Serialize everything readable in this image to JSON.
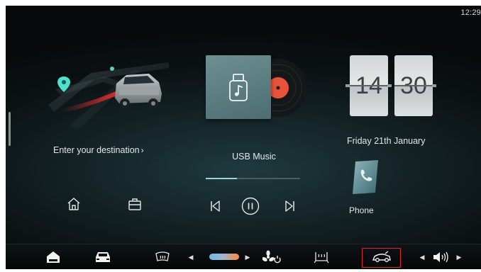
{
  "status": {
    "time": "12:29"
  },
  "navigation": {
    "destination_prompt": "Enter your destination",
    "icons": [
      "home-icon",
      "briefcase-icon"
    ]
  },
  "music": {
    "source_label": "USB Music",
    "progress": 0.33,
    "controls": [
      "previous-track-icon",
      "pause-icon",
      "next-track-icon"
    ]
  },
  "clock": {
    "hours": "14",
    "minutes": "30",
    "date": "Friday 21th January"
  },
  "phone": {
    "label": "Phone"
  },
  "dock": {
    "items": [
      "home-icon",
      "car-front-icon",
      "rear-defrost-icon",
      "temperature-slider",
      "fan-power-icon",
      "seat-heat-icon",
      "car-settings-icon",
      "volume-icon"
    ],
    "active_item": "car-settings-icon"
  },
  "colors": {
    "accent": "#9ed3dc",
    "active_border": "#e0262d",
    "temp_cold": "#6fb8e6",
    "temp_hot": "#ff8a3c"
  }
}
